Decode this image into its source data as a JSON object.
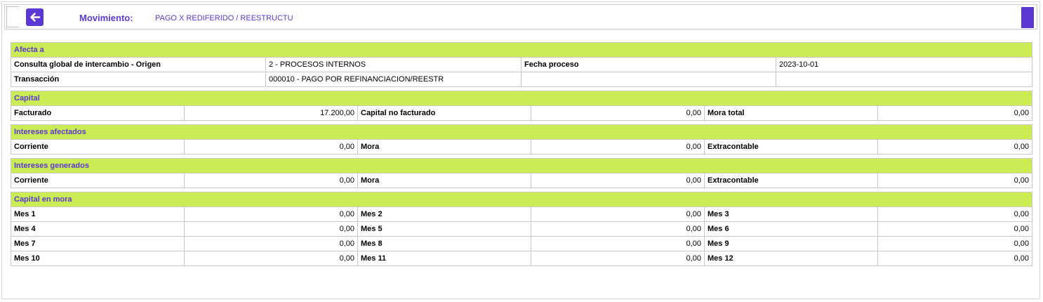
{
  "header": {
    "movimiento_label": "Movimiento:",
    "movimiento_value": "PAGO X REDIFERIDO / REESTRUCTU"
  },
  "afecta": {
    "title": "Afecta a",
    "rows": [
      [
        "Consulta global de intercambio - Origen",
        "2 - PROCESOS INTERNOS",
        "Fecha proceso",
        "2023-10-01"
      ],
      [
        "Transacción",
        "000010 - PAGO POR REFINANCIACION/REESTR",
        "",
        ""
      ]
    ]
  },
  "capital": {
    "title": "Capital",
    "row": [
      [
        "Facturado",
        "17.200,00"
      ],
      [
        "Capital no facturado",
        "0,00"
      ],
      [
        "Mora total",
        "0,00"
      ]
    ]
  },
  "intereses_afectados": {
    "title": "Intereses afectados",
    "row": [
      [
        "Corriente",
        "0,00"
      ],
      [
        "Mora",
        "0,00"
      ],
      [
        "Extracontable",
        "0,00"
      ]
    ]
  },
  "intereses_generados": {
    "title": "Intereses generados",
    "row": [
      [
        "Corriente",
        "0,00"
      ],
      [
        "Mora",
        "0,00"
      ],
      [
        "Extracontable",
        "0,00"
      ]
    ]
  },
  "capital_mora": {
    "title": "Capital en mora",
    "rows": [
      [
        [
          "Mes 1",
          "0,00"
        ],
        [
          "Mes 2",
          "0,00"
        ],
        [
          "Mes 3",
          "0,00"
        ]
      ],
      [
        [
          "Mes 4",
          "0,00"
        ],
        [
          "Mes 5",
          "0,00"
        ],
        [
          "Mes 6",
          "0,00"
        ]
      ],
      [
        [
          "Mes 7",
          "0,00"
        ],
        [
          "Mes 8",
          "0,00"
        ],
        [
          "Mes 9",
          "0,00"
        ]
      ],
      [
        [
          "Mes 10",
          "0,00"
        ],
        [
          "Mes 11",
          "0,00"
        ],
        [
          "Mes 12",
          "0,00"
        ]
      ]
    ]
  },
  "colors": {
    "accent": "#5b37d4",
    "section_bg": "#cbeb55",
    "border": "#c8c8c8"
  },
  "icons": {
    "back": "arrow-left-icon"
  }
}
